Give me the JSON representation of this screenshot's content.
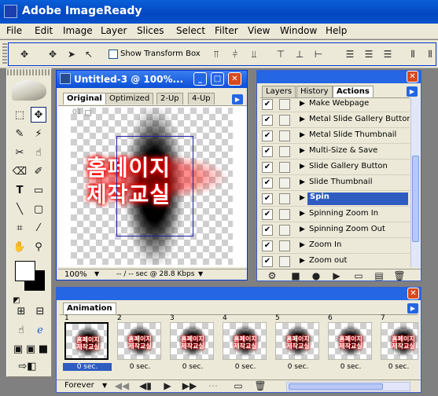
{
  "app": {
    "title": "Adobe ImageReady"
  },
  "menu": [
    "File",
    "Edit",
    "Image",
    "Layer",
    "Slices",
    "Select",
    "Filter",
    "View",
    "Window",
    "Help"
  ],
  "options_bar": {
    "show_transform_box": "Show Transform Box"
  },
  "document": {
    "title": "Untitled-3 @ 100%...",
    "tabs": [
      "Original",
      "Optimized",
      "2-Up",
      "4-Up"
    ],
    "active_tab": "Original",
    "corner_label": "01",
    "artwork_text_line1": "홈페이지",
    "artwork_text_line2": "제작교실",
    "zoom": "100%",
    "status": "-- / -- sec @ 28.8 Kbps"
  },
  "actions_panel": {
    "tabs": [
      "Layers",
      "History",
      "Actions"
    ],
    "active_tab": "Actions",
    "items": [
      {
        "label": "Make Webpage"
      },
      {
        "label": "Metal Slide Gallery Button"
      },
      {
        "label": "Metal Slide Thumbnail"
      },
      {
        "label": "Multi-Size & Save"
      },
      {
        "label": "Slide Gallery Button"
      },
      {
        "label": "Slide Thumbnail"
      },
      {
        "label": "Spin",
        "selected": true
      },
      {
        "label": "Spinning Zoom In"
      },
      {
        "label": "Spinning Zoom Out"
      },
      {
        "label": "Zoom In"
      },
      {
        "label": "Zoom out"
      }
    ]
  },
  "animation_panel": {
    "tab": "Animation",
    "thumb_text_line1": "홈페이지",
    "thumb_text_line2": "제작교실",
    "frames": [
      {
        "number": "1",
        "delay": "0 sec.",
        "selected": true
      },
      {
        "number": "2",
        "delay": "0 sec."
      },
      {
        "number": "3",
        "delay": "0 sec."
      },
      {
        "number": "4",
        "delay": "0 sec."
      },
      {
        "number": "5",
        "delay": "0 sec."
      },
      {
        "number": "6",
        "delay": "0 sec."
      },
      {
        "number": "7",
        "delay": "0 sec."
      }
    ],
    "loop": "Forever"
  },
  "colors": {
    "titlebar": "#0a5fd8",
    "selection": "#2f5cc0",
    "close_button": "#d8491e",
    "glow": "#ff0000"
  }
}
